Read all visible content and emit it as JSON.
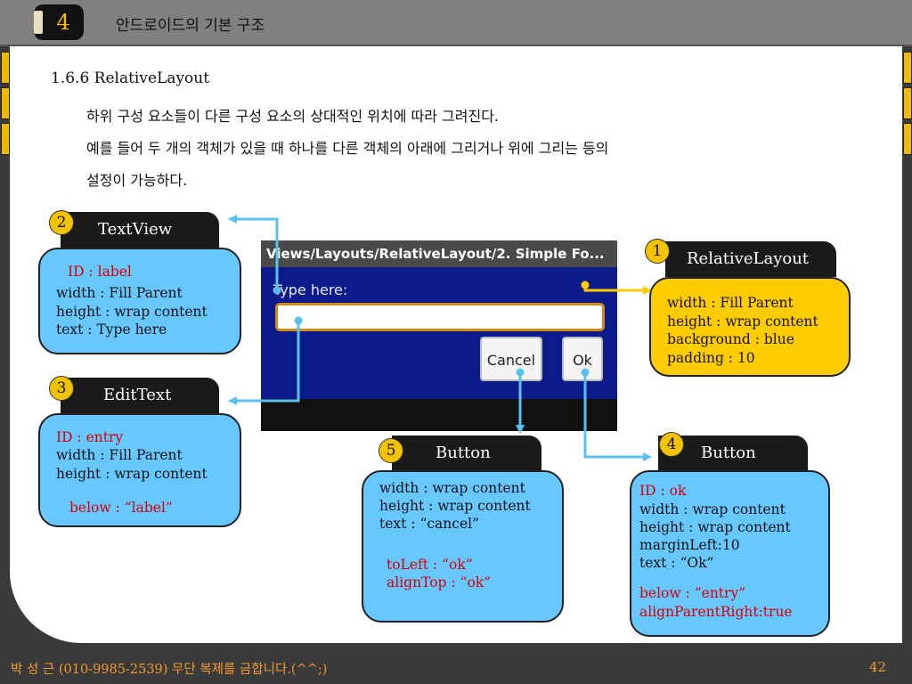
{
  "header": {
    "chapter_number": "4",
    "title": "안드로이드의 기본 구조"
  },
  "section_title": "1.6.6 RelativeLayout",
  "paragraphs": [
    "하위 구성 요소들이 다른 구성 요소의 상대적인 위치에 따라 그려진다.",
    "예를 들어 두 개의 객체가 있을 때 하나를 다른 객체의 아래에 그리거나 위에 그리는 등의",
    "설정이 가능하다."
  ],
  "screenshot": {
    "title": "Views/Layouts/RelativeLayout/2. Simple Fo...",
    "label": "Type here:",
    "cancel_label": "Cancel",
    "ok_label": "Ok"
  },
  "callouts": {
    "relative_layout": {
      "number": "1",
      "name": "RelativeLayout",
      "lines": [
        "width : Fill Parent",
        "height : wrap content",
        "background : blue",
        "padding : 10"
      ]
    },
    "textview": {
      "number": "2",
      "name": "TextView",
      "id": "ID : label",
      "lines": [
        "width : Fill Parent",
        "height : wrap content",
        "text : Type here"
      ]
    },
    "edittext": {
      "number": "3",
      "name": "EditText",
      "id": "ID : entry",
      "lines": [
        "width : Fill Parent",
        "height : wrap content"
      ],
      "rule": "below : “label”"
    },
    "ok_button": {
      "number": "4",
      "name": "Button",
      "id": "ID : ok",
      "lines": [
        "width : wrap content",
        "height : wrap content",
        "marginLeft:10",
        "text : “Ok”"
      ],
      "rules": [
        "below : “entry”",
        "alignParentRight:true"
      ]
    },
    "cancel_button": {
      "number": "5",
      "name": "Button",
      "lines": [
        "width : wrap content",
        "height : wrap content",
        "text : “cancel”"
      ],
      "rules": [
        "toLeft : “ok”",
        "alignTop : “ok”"
      ]
    }
  },
  "footer": {
    "author": "박 성 근 (010-9985-2539)  무단 복제를 금합니다.(^^;)",
    "page": "42"
  },
  "colors": {
    "accent": "#f3c200",
    "callout_blue": "#66c8ff",
    "callout_yellow": "#ffcc00",
    "connector": "#5bc0f0",
    "footer_text": "#f39a2c"
  }
}
